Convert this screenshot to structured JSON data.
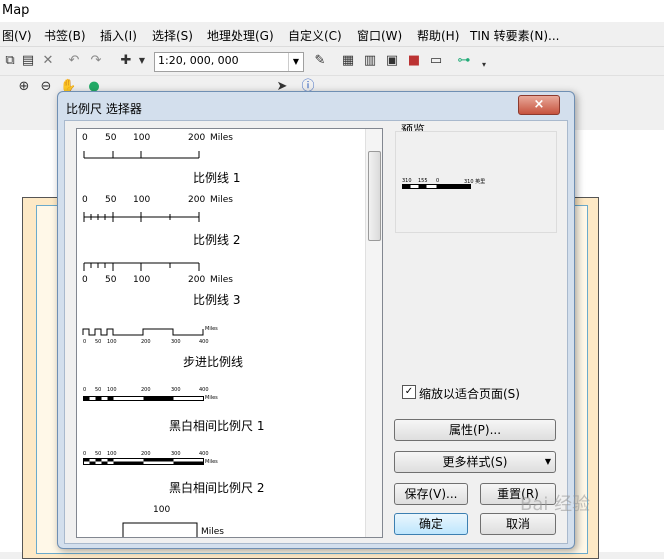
{
  "window": {
    "title": "Map"
  },
  "menu": {
    "items": [
      "图(V)",
      "书签(B)",
      "插入(I)",
      "选择(S)",
      "地理处理(G)",
      "自定义(C)",
      "窗口(W)",
      "帮助(H)",
      "TIN 转要素(N)..."
    ]
  },
  "toolbar": {
    "scale_value": "1:20, 000, 000"
  },
  "dialog": {
    "title": "比例尺 选择器",
    "close_glyph": "×",
    "styles": [
      {
        "name": "比例线 1",
        "tick_labels": [
          "0",
          "50",
          "100",
          "200",
          "Miles"
        ]
      },
      {
        "name": "比例线 2",
        "tick_labels": [
          "0",
          "50",
          "100",
          "200",
          "Miles"
        ]
      },
      {
        "name": "比例线 3",
        "tick_labels": [
          "0",
          "50",
          "100",
          "200",
          "Miles"
        ]
      },
      {
        "name": "步进比例线",
        "tick_labels": [
          "0",
          "50",
          "100",
          "200",
          "300",
          "400",
          "Miles"
        ]
      },
      {
        "name": "黑白相间比例尺 1",
        "tick_labels": [
          "0",
          "50",
          "100",
          "200",
          "300",
          "400",
          "Miles"
        ]
      },
      {
        "name": "黑白相间比例尺 2",
        "tick_labels": [
          "0",
          "50",
          "100",
          "200",
          "300",
          "400",
          "Miles"
        ]
      },
      {
        "name": "",
        "tick_labels": [
          "100",
          "Miles"
        ]
      }
    ],
    "preview": {
      "label": "预览",
      "tick_labels": [
        "310",
        "155",
        "0",
        "310 英里"
      ]
    },
    "fit_to_page": {
      "label": "缩放以适合页面(S)",
      "checked": true
    },
    "buttons": {
      "properties": "属性(P)...",
      "more_styles": "更多样式(S)",
      "save": "保存(V)...",
      "reset": "重置(R)",
      "ok": "确定",
      "cancel": "取消"
    }
  },
  "watermark": {
    "text": "Bai 经验"
  }
}
